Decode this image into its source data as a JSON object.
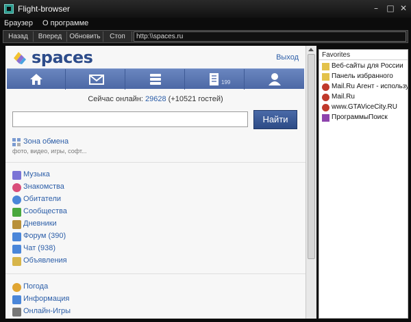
{
  "window": {
    "title": "Flight-browser",
    "controls": {
      "minimize": "–",
      "maximize": "□",
      "close": "✕"
    }
  },
  "menu": [
    "Браузер",
    "О программе"
  ],
  "toolbar": {
    "back": "Назад",
    "forward": "Вперед",
    "refresh": "Обновить",
    "stop": "Стоп",
    "url": "http:\\\\spaces.ru"
  },
  "page": {
    "logo": "spaces",
    "logout": "Выход",
    "nav": {
      "icons": [
        "home-icon",
        "mail-icon",
        "stack-icon",
        "journal-icon",
        "user-icon"
      ],
      "journal_count": "199"
    },
    "online": {
      "prefix": "Сейчас онлайн: ",
      "count": "29628",
      "guests": " (+10521 гостей)"
    },
    "search": {
      "value": "",
      "button": "Найти"
    },
    "zone": {
      "title": "Зона обмена",
      "subtitle": "фото, видео, игры, софт..."
    },
    "section1": [
      {
        "label": "Музыка",
        "icon": "music-note-icon",
        "color": "#7b74d6"
      },
      {
        "label": "Знакомства",
        "icon": "heart-icon",
        "color": "#d94d7a"
      },
      {
        "label": "Обитатели",
        "icon": "person-icon",
        "color": "#4a86d9"
      },
      {
        "label": "Сообщества",
        "icon": "group-icon",
        "color": "#49a83e"
      },
      {
        "label": "Дневники",
        "icon": "pencil-icon",
        "color": "#b8903a"
      },
      {
        "label": "Форум (390)",
        "icon": "forum-icon",
        "color": "#4a86d9"
      },
      {
        "label": "Чат (938)",
        "icon": "chat-icon",
        "color": "#4a86d9"
      },
      {
        "label": "Объявления",
        "icon": "ads-icon",
        "color": "#d7b54a"
      }
    ],
    "section2": [
      {
        "label": "Погода",
        "icon": "weather-icon",
        "color": "#e0a532"
      },
      {
        "label": "Информация",
        "icon": "info-icon",
        "color": "#4a86d9"
      },
      {
        "label": "Онлайн-Игры",
        "icon": "games-icon",
        "color": "#777777"
      }
    ]
  },
  "favorites": {
    "title": "Favorites",
    "items": [
      {
        "label": "Веб-сайты для России",
        "icon": "folder-icon",
        "color": "#e3c24a"
      },
      {
        "label": "Панель избранного",
        "icon": "folder-icon",
        "color": "#e3c24a"
      },
      {
        "label": "Mail.Ru Агент - использу",
        "icon": "mailru-icon",
        "color": "#c0392b"
      },
      {
        "label": "Mail.Ru",
        "icon": "mailru-icon",
        "color": "#c0392b"
      },
      {
        "label": "www.GTAViceCity.RU",
        "icon": "mailru-icon",
        "color": "#c0392b"
      },
      {
        "label": "ПрограммыПоиск",
        "icon": "s-logo-icon",
        "color": "#8e44ad"
      }
    ]
  }
}
